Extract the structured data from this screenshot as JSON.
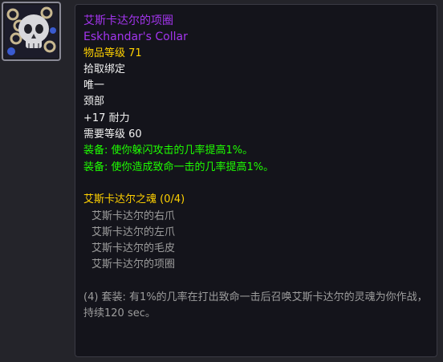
{
  "item": {
    "name_zh": "艾斯卡达尔的项圈",
    "name_en": "Eskhandar's Collar",
    "item_level": "物品等级 71",
    "binding": "拾取绑定",
    "unique": "唯一",
    "slot": "颈部",
    "stat": "+17 耐力",
    "required_level": "需要等级 60",
    "equip_effects": [
      "装备: 使你躲闪攻击的几率提高1%。",
      "装备: 使你造成致命一击的几率提高1%。"
    ]
  },
  "set": {
    "title": "艾斯卡达尔之魂 (0/4)",
    "pieces": [
      "艾斯卡达尔的右爪",
      "艾斯卡达尔的左爪",
      "艾斯卡达尔的毛皮",
      "艾斯卡达尔的项圈"
    ],
    "bonus": "(4) 套装: 有1%的几率在打出致命一击后召唤艾斯卡达尔的灵魂为你作战，持续120 sec。"
  },
  "colors": {
    "epic": "#a335ee",
    "highlight": "#ffd100",
    "green": "#1eff00",
    "grey": "#9d9d9d"
  },
  "icon": "skull-collar-icon"
}
